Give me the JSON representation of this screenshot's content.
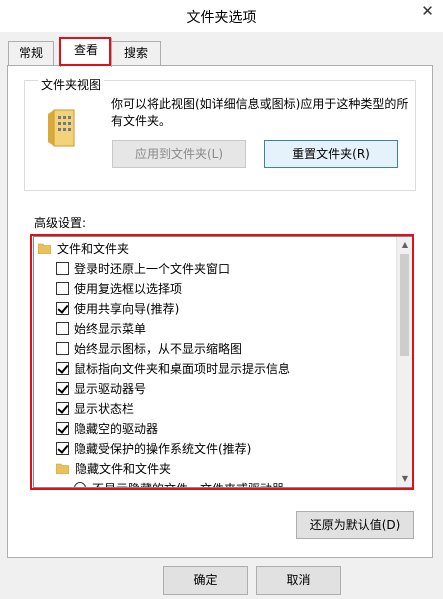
{
  "window": {
    "title": "文件夹选项",
    "close_glyph": "✕"
  },
  "tabs": [
    {
      "label": "常规",
      "active": false
    },
    {
      "label": "查看",
      "active": true
    },
    {
      "label": "搜索",
      "active": false
    }
  ],
  "folder_views": {
    "group_label": "文件夹视图",
    "description": "你可以将此视图(如详细信息或图标)应用于这种类型的所有文件夹。",
    "apply_button": "应用到文件夹(L)",
    "reset_button": "重置文件夹(R)"
  },
  "advanced": {
    "label": "高级设置:",
    "items": [
      {
        "type": "folder",
        "label": "文件和文件夹",
        "indent": 0
      },
      {
        "type": "checkbox",
        "label": "登录时还原上一个文件夹窗口",
        "checked": false,
        "indent": 1
      },
      {
        "type": "checkbox",
        "label": "使用复选框以选择项",
        "checked": false,
        "indent": 1
      },
      {
        "type": "checkbox",
        "label": "使用共享向导(推荐)",
        "checked": true,
        "indent": 1
      },
      {
        "type": "checkbox",
        "label": "始终显示菜单",
        "checked": false,
        "indent": 1
      },
      {
        "type": "checkbox",
        "label": "始终显示图标，从不显示缩略图",
        "checked": false,
        "indent": 1
      },
      {
        "type": "checkbox",
        "label": "鼠标指向文件夹和桌面项时显示提示信息",
        "checked": true,
        "indent": 1
      },
      {
        "type": "checkbox",
        "label": "显示驱动器号",
        "checked": true,
        "indent": 1
      },
      {
        "type": "checkbox",
        "label": "显示状态栏",
        "checked": true,
        "indent": 1
      },
      {
        "type": "checkbox",
        "label": "隐藏空的驱动器",
        "checked": true,
        "indent": 1
      },
      {
        "type": "checkbox",
        "label": "隐藏受保护的操作系统文件(推荐)",
        "checked": true,
        "indent": 1
      },
      {
        "type": "folder",
        "label": "隐藏文件和文件夹",
        "indent": 1
      },
      {
        "type": "radio",
        "label": "不显示隐藏的文件、文件夹或驱动器",
        "checked": false,
        "indent": 2
      }
    ],
    "restore_button": "还原为默认值(D)",
    "scroll_up_glyph": "▲",
    "scroll_down_glyph": "▼"
  },
  "footer": {
    "ok_button": "确定",
    "cancel_button": "取消"
  },
  "colors": {
    "highlight": "#e0101a",
    "folder": "#e8c15a"
  }
}
